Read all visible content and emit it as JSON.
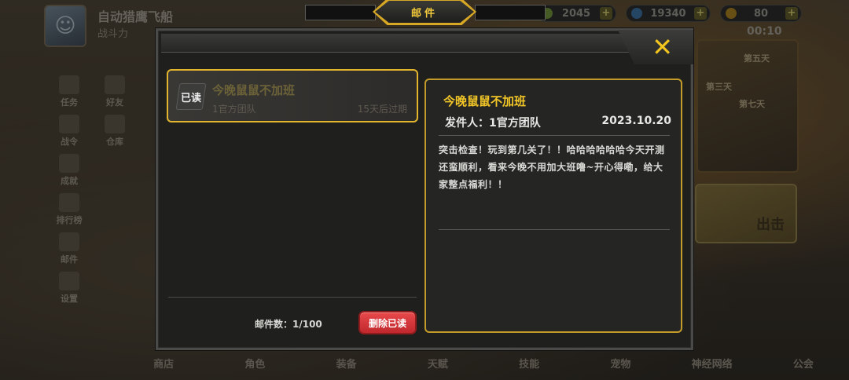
{
  "background": {
    "player_name": "自动猎鹰飞船",
    "player_power_label": "战斗力",
    "currencies": [
      {
        "icon": "coin-icon",
        "value": "2045",
        "color": "#6a8a3a"
      },
      {
        "icon": "gem-icon",
        "value": "19340",
        "color": "#3a6a9a"
      },
      {
        "icon": "energy-icon",
        "value": "80",
        "color": "#a07a20"
      }
    ],
    "timer": "00:10",
    "side_menu": [
      "任务",
      "战令",
      "成就",
      "排行榜",
      "邮件",
      "设置"
    ],
    "side_menu2": [
      "好友",
      "仓库"
    ],
    "bottom_tabs": [
      "商店",
      "角色",
      "装备",
      "天赋",
      "技能",
      "宠物",
      "神经网络",
      "公会"
    ],
    "event_days": [
      "第五天",
      "第三天",
      "第七天"
    ],
    "go_label": "出击"
  },
  "dialog": {
    "title": "邮件",
    "close_glyph": "✕",
    "mail_list": [
      {
        "status": "已读",
        "subject": "今晚鼠鼠不加班",
        "sender": "1官方团队",
        "expire": "15天后过期"
      }
    ],
    "mail_count": "邮件数：1/100",
    "delete_read_label": "删除已读",
    "detail": {
      "subject": "今晚鼠鼠不加班",
      "sender": "发件人：1官方团队",
      "date": "2023.10.20",
      "body": "突击检查！玩到第几关了！！哈哈哈哈哈哈今天开测还蛮顺利，看来今晚不用加大班噜~开心得嘞，给大家整点福利！！"
    }
  },
  "colors": {
    "accent_gold": "#e2b52c",
    "title_gold": "#f2c627",
    "delete_red": "#d3363a"
  }
}
